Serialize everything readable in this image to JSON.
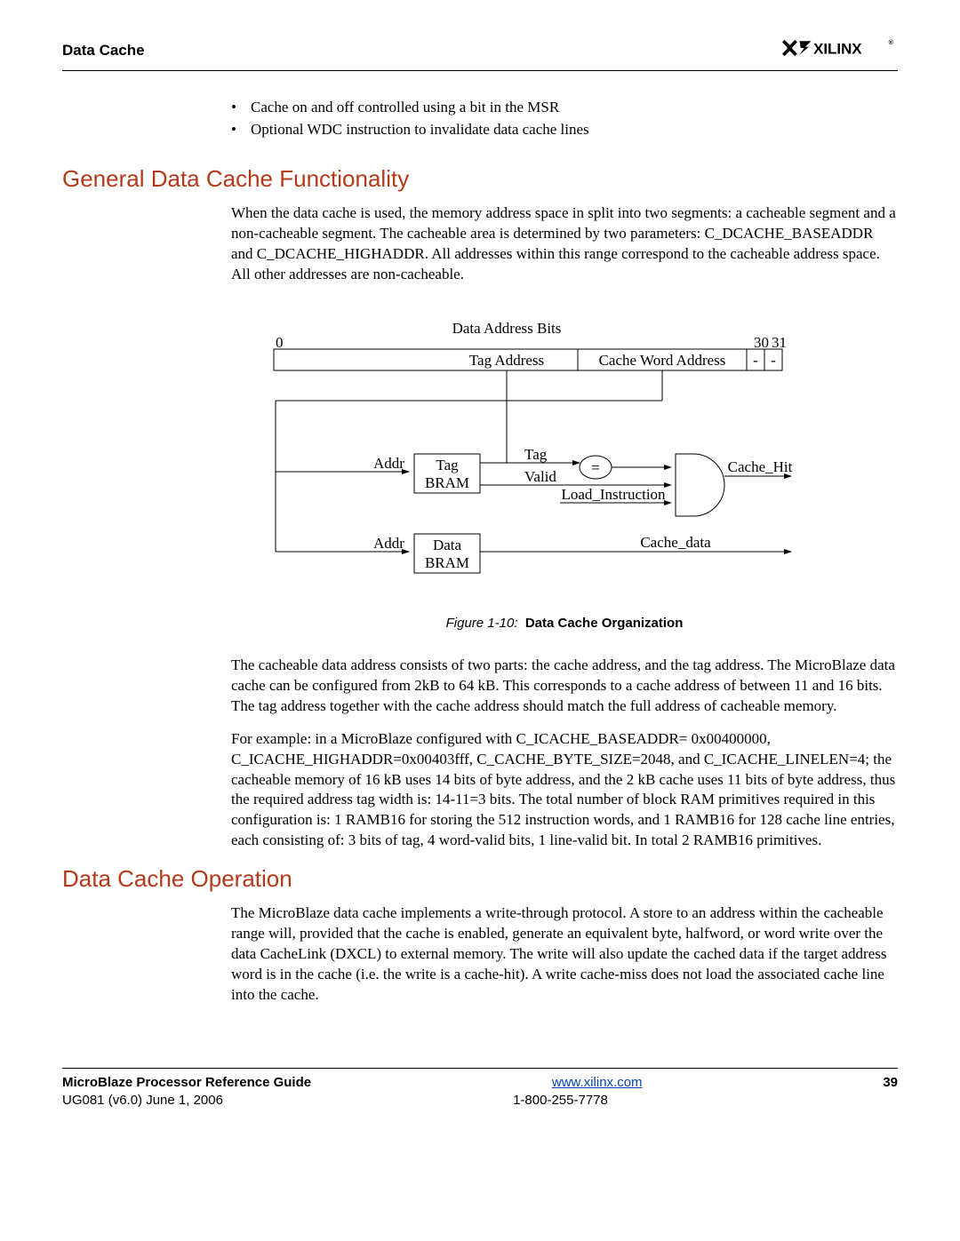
{
  "header": {
    "section": "Data Cache",
    "logo_text": "XILINX",
    "logo_reg": "®"
  },
  "bullets": [
    "Cache on and off controlled using a bit in the MSR",
    "Optional WDC instruction to invalidate data cache lines"
  ],
  "sec1": {
    "title": "General Data Cache Functionality",
    "p1": "When the data cache is used, the memory address space in split into two segments: a cacheable segment and a non-cacheable segment. The cacheable area is determined by two parameters: C_DCACHE_BASEADDR and C_DCACHE_HIGHADDR. All addresses within this range correspond to the cacheable address space. All other addresses are non-cacheable."
  },
  "figure": {
    "caption_label": "Figure 1-10:",
    "caption_title": "Data Cache Organization",
    "labels": {
      "title": "Data Address Bits",
      "bit0": "0",
      "bit30": "30",
      "bit31": "31",
      "tag_addr": "Tag Address",
      "cwa": "Cache Word Address",
      "dash": "-",
      "addr1": "Addr",
      "addr2": "Addr",
      "tag_bram": "Tag\nBRAM",
      "data_bram": "Data\nBRAM",
      "tag": "Tag",
      "valid": "Valid",
      "eq": "=",
      "load_instr": "Load_Instruction",
      "cache_hit": "Cache_Hit",
      "cache_data": "Cache_data"
    }
  },
  "after_fig": {
    "p1": "The cacheable data address consists of two parts: the cache address, and the tag address. The MicroBlaze data cache can be configured from 2kB to 64 kB. This corresponds to a cache address of between 11 and 16 bits. The tag address together with the cache address should match the full address of cacheable memory.",
    "p2": "For example: in a MicroBlaze configured with C_ICACHE_BASEADDR= 0x00400000, C_ICACHE_HIGHADDR=0x00403fff, C_CACHE_BYTE_SIZE=2048, and C_ICACHE_LINELEN=4; the cacheable memory of 16 kB uses 14 bits of byte address, and the 2 kB cache uses 11 bits of byte address, thus the required address tag width is: 14-11=3 bits. The total number of block RAM primitives required in this configuration is: 1 RAMB16 for storing the 512 instruction words, and 1 RAMB16 for 128 cache line entries, each consisting of: 3 bits of tag, 4 word-valid bits, 1 line-valid bit. In total 2 RAMB16 primitives."
  },
  "sec2": {
    "title": "Data Cache Operation",
    "p1": "The MicroBlaze data cache implements a write-through protocol. A store to an address within the cacheable range will, provided that the cache is enabled, generate an equivalent byte, halfword, or word write over the data CacheLink (DXCL) to external memory. The write will also update the cached data if the target address word is in the cache (i.e. the write is a cache-hit). A write cache-miss does not load the associated cache line into the cache."
  },
  "footer": {
    "left1": "MicroBlaze Processor Reference Guide",
    "left2": "UG081 (v6.0) June 1, 2006",
    "link": "www.xilinx.com",
    "phone": "1-800-255-7778",
    "page": "39"
  }
}
